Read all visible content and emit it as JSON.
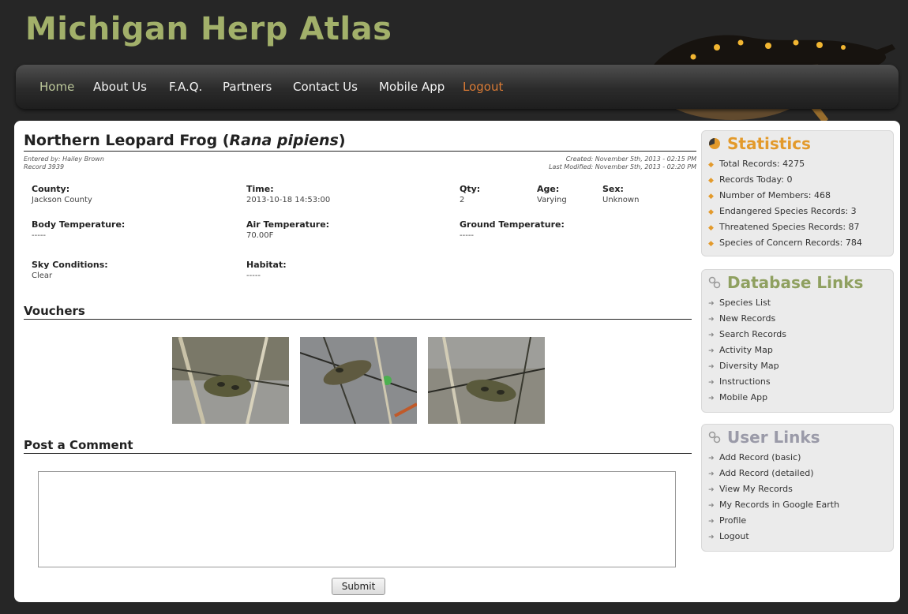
{
  "site": {
    "title": "Michigan Herp Atlas"
  },
  "nav": [
    {
      "label": "Home",
      "name": "nav-home"
    },
    {
      "label": "About Us",
      "name": "nav-about-us"
    },
    {
      "label": "F.A.Q.",
      "name": "nav-faq"
    },
    {
      "label": "Partners",
      "name": "nav-partners"
    },
    {
      "label": "Contact Us",
      "name": "nav-contact-us"
    },
    {
      "label": "Mobile App",
      "name": "nav-mobile-app"
    },
    {
      "label": "Logout",
      "name": "nav-logout"
    }
  ],
  "record": {
    "common_name": "Northern Leopard Frog (",
    "scientific_name": "Rana pipiens",
    "close_paren": ")",
    "entered_by": "Entered by: Hailey Brown",
    "record_no": "Record 3939",
    "created": "Created: November 5th, 2013 - 02:15 PM",
    "modified": "Last Modified: November 5th, 2013 - 02:20 PM",
    "fields": {
      "county_label": "County:",
      "county": "Jackson County",
      "time_label": "Time:",
      "time": "2013-10-18 14:53:00",
      "qty_label": "Qty:",
      "qty": "2",
      "age_label": "Age:",
      "age": "Varying",
      "sex_label": "Sex:",
      "sex": "Unknown",
      "body_temp_label": "Body Temperature:",
      "body_temp": "-----",
      "air_temp_label": "Air Temperature:",
      "air_temp": "70.00F",
      "ground_temp_label": "Ground Temperature:",
      "ground_temp": "-----",
      "sky_label": "Sky Conditions:",
      "sky": "Clear",
      "habitat_label": "Habitat:",
      "habitat": "-----"
    }
  },
  "vouchers": {
    "title": "Vouchers"
  },
  "comment": {
    "title": "Post a Comment",
    "submit_label": "Submit"
  },
  "statistics": {
    "title": "Statistics",
    "items": [
      "Total Records: 4275",
      "Records Today: 0",
      "Number of Members: 468",
      "Endangered Species Records: 3",
      "Threatened Species Records: 87",
      "Species of Concern Records: 784"
    ]
  },
  "database_links": {
    "title": "Database Links",
    "items": [
      "Species List",
      "New Records",
      "Search Records",
      "Activity Map",
      "Diversity Map",
      "Instructions",
      "Mobile App"
    ]
  },
  "user_links": {
    "title": "User Links",
    "items": [
      "Add Record (basic)",
      "Add Record (detailed)",
      "View My Records",
      "My Records in Google Earth",
      "Profile",
      "Logout"
    ]
  },
  "colors": {
    "title_green": "#a2b06a",
    "statistics_title": "#e39a2b",
    "links_title": "#8fa060",
    "user_links_title": "#9a9aa8",
    "logout_orange": "#d97a35"
  }
}
